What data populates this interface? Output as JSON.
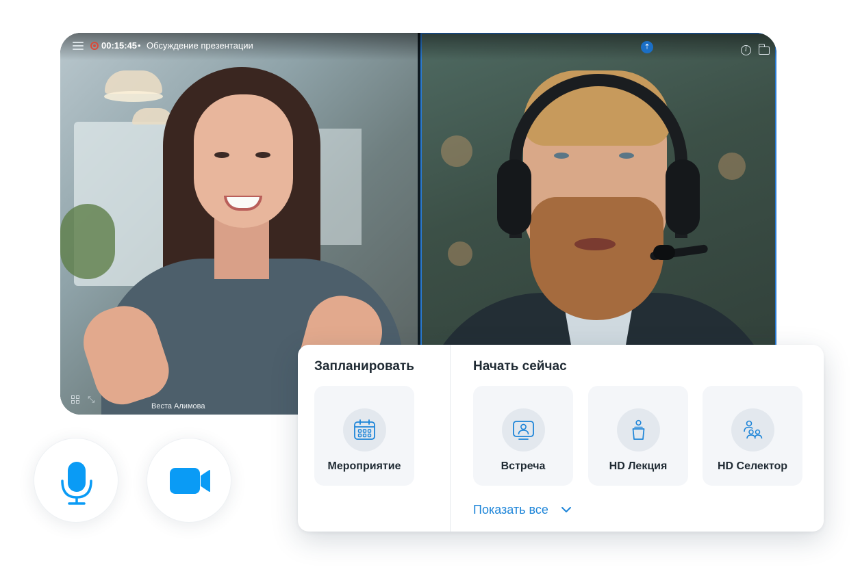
{
  "call": {
    "timer": "00:15:45",
    "separator": "•",
    "meeting_title": "Обсуждение презентации",
    "participant_left_name": "Веста Алимова",
    "signal_glyph": "⇡",
    "info_glyph": "i",
    "shrink_glyph": "⤡"
  },
  "icons": {
    "menu": "menu-icon",
    "record": "record-icon",
    "signal": "signal-icon",
    "info": "info-icon",
    "folder": "folder-icon",
    "grid": "grid-icon",
    "shrink": "shrink-icon",
    "mic": "microphone-icon",
    "camera": "camera-icon",
    "calendar": "calendar-icon",
    "meeting": "screen-person-icon",
    "lecture": "lecture-icon",
    "selector": "group-icon",
    "chevron": "chevron-down-icon"
  },
  "colors": {
    "accent": "#1c84d8",
    "control_blue": "#0a9bf5",
    "record_red": "#d84a3a",
    "text_dark": "#1f2a33",
    "card_bg": "#f4f6f9",
    "icon_circle": "#e3e8ee"
  },
  "panel": {
    "schedule": {
      "heading": "Запланировать",
      "items": [
        {
          "label": "Мероприятие",
          "icon": "calendar-icon"
        }
      ]
    },
    "start_now": {
      "heading": "Начать сейчас",
      "items": [
        {
          "label": "Встреча",
          "icon": "screen-person-icon"
        },
        {
          "label": "HD Лекция",
          "icon": "lecture-icon"
        },
        {
          "label": "HD Селектор",
          "icon": "group-icon"
        }
      ]
    },
    "show_all": "Показать все"
  }
}
